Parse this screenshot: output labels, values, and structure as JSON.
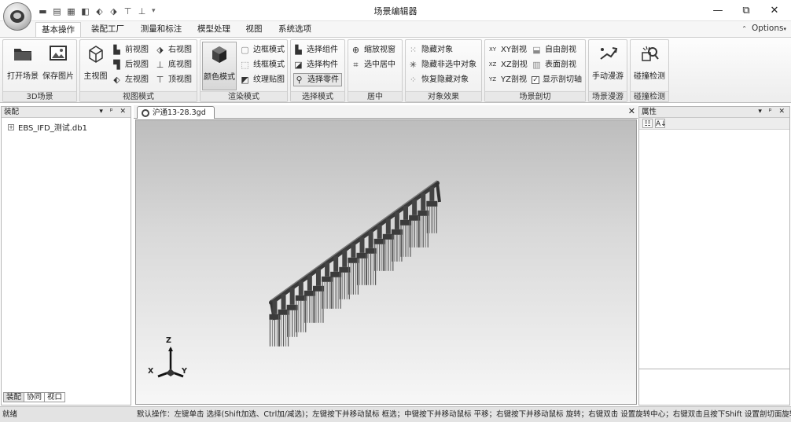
{
  "window": {
    "title": "场景编辑器"
  },
  "quick_access": {
    "icons": [
      "new-file-icon",
      "open-icon",
      "save-icon",
      "view-front-icon",
      "view-left-icon",
      "view-right-icon",
      "view-top-icon",
      "view-bottom-icon"
    ],
    "overflow": "▾"
  },
  "window_controls": {
    "minimize": "—",
    "maximize": "⧉",
    "close": "✕"
  },
  "tabs": [
    "基本操作",
    "装配工厂",
    "测量和标注",
    "模型处理",
    "视图",
    "系统选项"
  ],
  "active_tab": "基本操作",
  "options": {
    "label": "Options",
    "collapse": "⌃"
  },
  "ribbon": {
    "scene_3d": {
      "label": "3D场景",
      "open": "打开场景",
      "save_image": "保存图片"
    },
    "view_mode": {
      "label": "视图模式",
      "main_view": "主视图",
      "front": "前视图",
      "back": "后视图",
      "left": "左视图",
      "right": "右视图",
      "bottom": "底视图",
      "top": "顶视图"
    },
    "render_mode": {
      "label": "渲染模式",
      "color": "颜色模式",
      "border": "边框模式",
      "wireframe": "线框模式",
      "texture": "纹理贴图"
    },
    "select_mode": {
      "label": "选择模式",
      "component": "选择组件",
      "part_component": "选择构件",
      "part": "选择零件"
    },
    "center": {
      "label": "居中",
      "zoom_window": "缩放视窗",
      "center_selected": "选中居中"
    },
    "object_effect": {
      "label": "对象效果",
      "hide": "隐藏对象",
      "hide_unselected": "隐藏非选中对象",
      "restore_hidden": "恢复隐藏对象"
    },
    "section": {
      "label": "场景剖切",
      "xy": "XY剖视",
      "xz": "XZ剖视",
      "yz": "YZ剖视",
      "free": "自由剖视",
      "surface": "表面剖视",
      "show_axis": "显示剖切轴",
      "show_axis_checked": "✓"
    },
    "roam": {
      "label": "场景漫游",
      "manual": "手动漫游"
    },
    "collision": {
      "label": "碰撞检测",
      "detect": "碰撞检测"
    }
  },
  "left_panel": {
    "title": "装配",
    "controls": "▾ ᵖ ✕",
    "tree": [
      {
        "expander": "+",
        "label": "EBS_IFD_测试.db1"
      }
    ],
    "bottom_tabs": [
      "装配",
      "协同",
      "视口"
    ]
  },
  "document": {
    "tab": "沪通13-28.3gd",
    "close": "✕"
  },
  "viewport": {
    "axes": {
      "z": "Z",
      "x": "X",
      "y": "Y"
    }
  },
  "right_panel": {
    "title": "属性",
    "controls": "▾ ᵖ ✕",
    "sort_categorized": "☷",
    "sort_alpha": "A↓"
  },
  "status": {
    "left": "就绪",
    "message": "默认操作：左键单击 选择(Shift加选、Ctrl加/减选)；左键按下并移动鼠标 框选；中键按下并移动鼠标 平移；右键按下并移动鼠标 旋转；右键双击 设置旋转中心；右键双击且按下Shift 设置剖切面旋转"
  }
}
